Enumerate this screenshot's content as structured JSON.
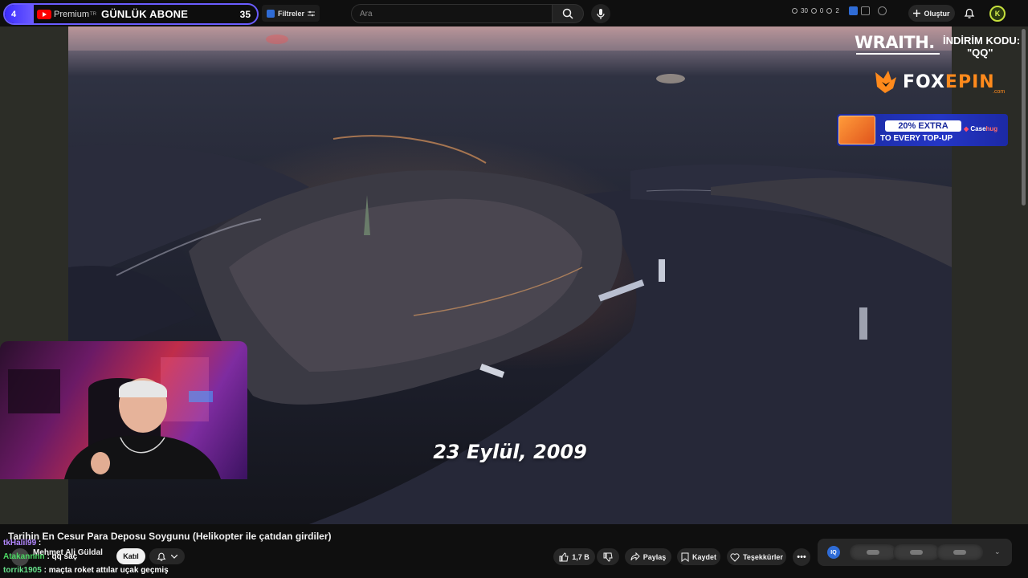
{
  "subscriber_widget": {
    "left_count": "4",
    "brand": "Premium",
    "region": "TR",
    "label": "GÜNLÜK ABONE",
    "right_count": "35"
  },
  "toolbar": {
    "filters_label": "Filtreler",
    "search_placeholder": "Ara",
    "stats": [
      "30",
      "0",
      "2"
    ],
    "create_label": "Oluştur",
    "avatar_letter": "K"
  },
  "video": {
    "caption": "23 Eylül, 2009"
  },
  "overlay": {
    "wraith": "WRAITH.",
    "discount_label": "İNDİRİM KODU:",
    "discount_code": "\"QQ\"",
    "foxepin_a": "FOX",
    "foxepin_b": "EPIN",
    "foxepin_com": ".com",
    "promo_pill": "20% EXTRA",
    "promo_sub": "TO EVERY TOP-UP",
    "promo_brand_a": "Case",
    "promo_brand_b": "hug"
  },
  "info": {
    "title": "Tarihin En Cesur Para Deposu Soygunu (Helikopter ile çatıdan girdiler)",
    "channel": "Mehmet Ali Güldal",
    "join_label": "Katıl",
    "likes": "1,7 B",
    "share_label": "Paylaş",
    "save_label": "Kaydet",
    "thanks_label": "Teşekkürler",
    "more_label": "•••",
    "ext_logo": "IQ"
  },
  "chat": [
    {
      "user": "tkHalil99",
      "msg": ":",
      "color": "#b388ff"
    },
    {
      "user": "Atakannnn",
      "msg": ": qq saç",
      "color": "#4cd964"
    },
    {
      "user": "torrik1905",
      "msg": ": maçta roket attılar uçak geçmiş",
      "color": "#66e08a"
    }
  ],
  "colors": {
    "accent": "#6a5cff",
    "youtube_red": "#ff0000",
    "foxepin_orange": "#ff8a1c",
    "promo_blue": "#2436c6"
  }
}
